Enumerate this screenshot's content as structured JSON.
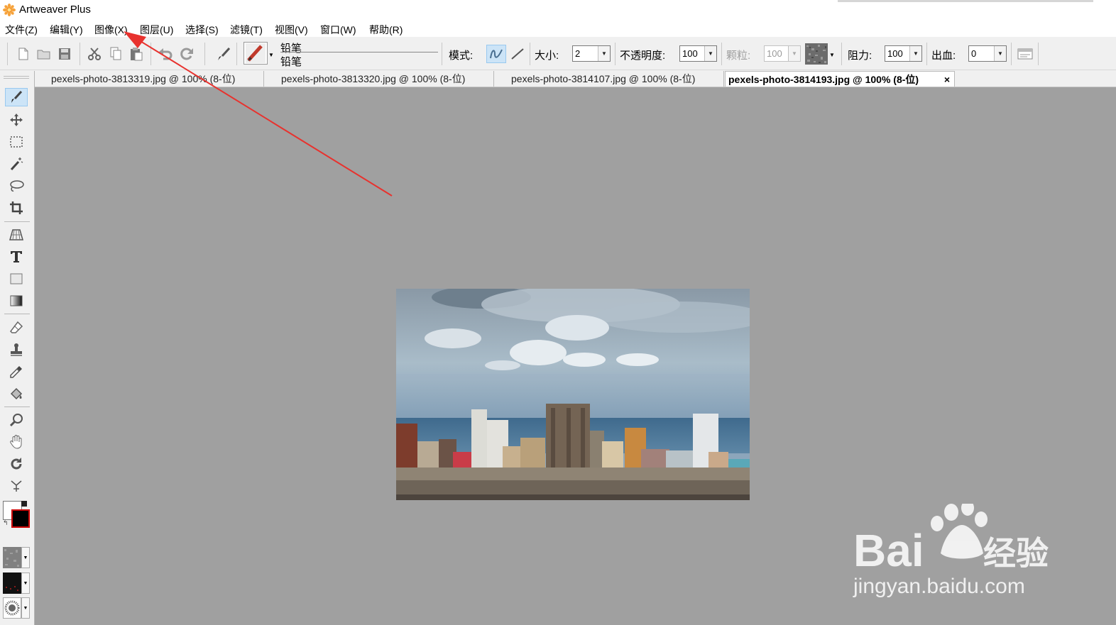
{
  "window": {
    "title": "Artweaver Plus"
  },
  "menu": [
    "文件(Z)",
    "编辑(Y)",
    "图像(X)",
    "图层(U)",
    "选择(S)",
    "滤镜(T)",
    "视图(V)",
    "窗口(W)",
    "帮助(R)"
  ],
  "toolbar": {
    "brush_name_1": "铅笔",
    "brush_name_2": "铅笔",
    "mode_label": "模式:",
    "size_label": "大小:",
    "size_value": "2",
    "opacity_label": "不透明度:",
    "opacity_value": "100",
    "grain_label": "颗粒:",
    "grain_value": "100",
    "resist_label": "阻力:",
    "resist_value": "100",
    "bleed_label": "出血:",
    "bleed_value": "0"
  },
  "tabs": [
    {
      "label": "pexels-photo-3813319.jpg @ 100% (8-位)",
      "active": false
    },
    {
      "label": "pexels-photo-3813320.jpg @ 100% (8-位)",
      "active": false
    },
    {
      "label": "pexels-photo-3814107.jpg @ 100% (8-位)",
      "active": false
    },
    {
      "label": "pexels-photo-3814193.jpg @ 100% (8-位)",
      "active": true
    }
  ],
  "tab_close_glyph": "×",
  "tools": [
    "brush-icon",
    "move-icon",
    "rect-select-icon",
    "magic-wand-icon",
    "lasso-icon",
    "crop-icon",
    "perspective-icon",
    "text-icon",
    "shape-icon",
    "gradient-icon",
    "eraser-icon",
    "clone-stamp-icon",
    "eyedropper-icon",
    "paint-bucket-icon",
    "zoom-icon",
    "hand-icon",
    "rotate-icon",
    "transform-icon"
  ],
  "colors": {
    "canvas_bg": "#a0a0a0",
    "annotation_arrow": "#e8322e",
    "active_tool": "#cce4f7",
    "foreground": "#000000",
    "background": "#ffffff"
  },
  "watermark": {
    "brand": "Bai",
    "brand_suffix": "经验",
    "url": "jingyan.baidu.com"
  }
}
